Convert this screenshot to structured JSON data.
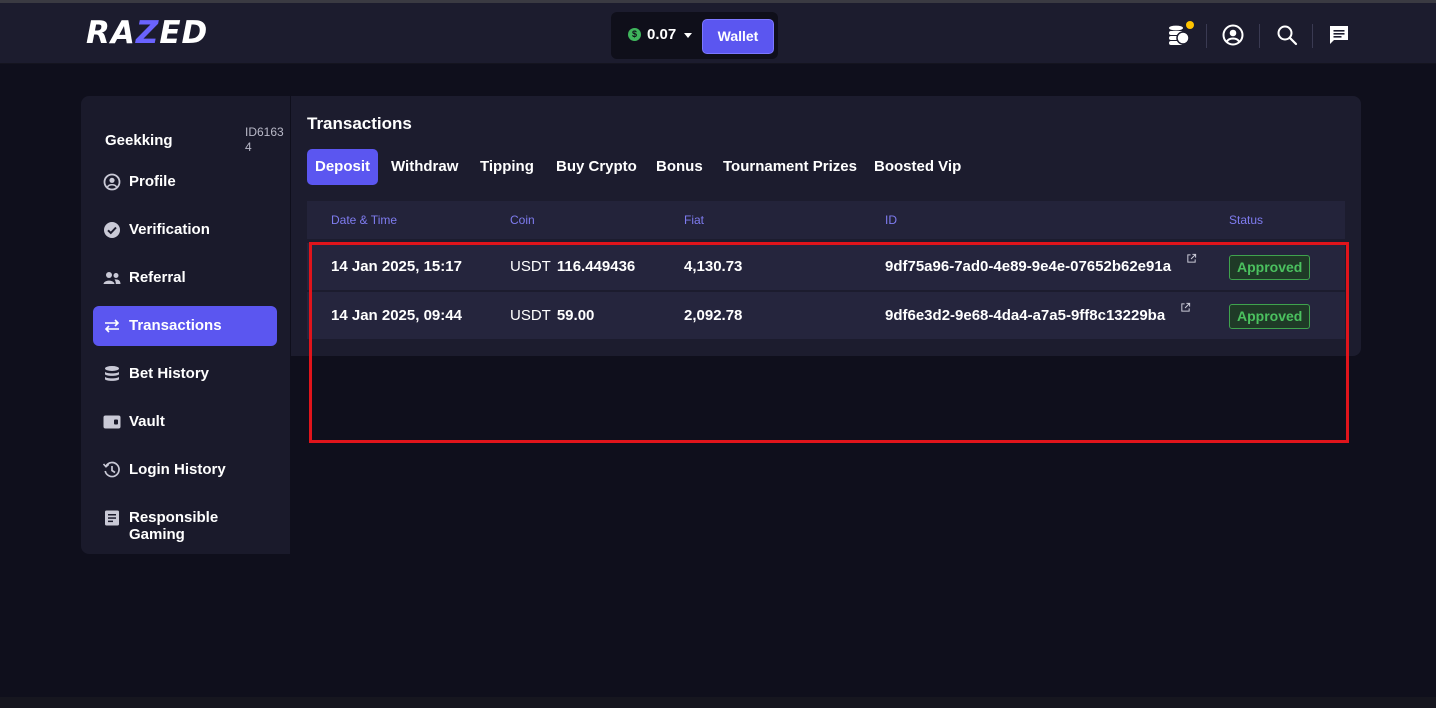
{
  "header": {
    "logo": {
      "text_left": "RA",
      "text_accent": "Z",
      "text_right": "ED",
      "accent_color": "#6a63ff"
    },
    "balance": {
      "currency_symbol": "$",
      "amount": "0.07"
    },
    "wallet_label": "Wallet",
    "icons": [
      "coins-icon",
      "account-icon",
      "search-icon",
      "chat-icon"
    ]
  },
  "sidebar": {
    "username": "Geekking",
    "user_id": "ID61634",
    "items": [
      {
        "label": "Profile",
        "icon": "profile-icon",
        "active": false
      },
      {
        "label": "Verification",
        "icon": "check-circle-icon",
        "active": false
      },
      {
        "label": "Referral",
        "icon": "users-icon",
        "active": false
      },
      {
        "label": "Transactions",
        "icon": "transfer-icon",
        "active": true
      },
      {
        "label": "Bet History",
        "icon": "stack-icon",
        "active": false
      },
      {
        "label": "Vault",
        "icon": "vault-icon",
        "active": false
      },
      {
        "label": "Login History",
        "icon": "history-icon",
        "active": false
      },
      {
        "label": "Responsible Gaming",
        "icon": "document-icon",
        "active": false
      }
    ]
  },
  "main": {
    "title": "Transactions",
    "tabs": [
      {
        "label": "Deposit",
        "active": true
      },
      {
        "label": "Withdraw",
        "active": false
      },
      {
        "label": "Tipping",
        "active": false
      },
      {
        "label": "Buy Crypto",
        "active": false
      },
      {
        "label": "Bonus",
        "active": false
      },
      {
        "label": "Tournament Prizes",
        "active": false
      },
      {
        "label": "Boosted Vip",
        "active": false
      }
    ],
    "columns": [
      "Date & Time",
      "Coin",
      "Fiat",
      "ID",
      "Status"
    ],
    "rows": [
      {
        "datetime": "14 Jan 2025, 15:17",
        "coin": "USDT",
        "amount": "116.449436",
        "fiat": "4,130.73",
        "id": "9df75a96-7ad0-4e89-9e4e-07652b62e91a",
        "status": "Approved"
      },
      {
        "datetime": "14 Jan 2025, 09:44",
        "coin": "USDT",
        "amount": "59.00",
        "fiat": "2,092.78",
        "id": "9df6e3d2-9e68-4da4-a7a5-9ff8c13229ba",
        "status": "Approved"
      }
    ]
  },
  "colors": {
    "accent": "#5b56f0",
    "approved": "#4bc15f",
    "highlight": "#e0141b"
  }
}
